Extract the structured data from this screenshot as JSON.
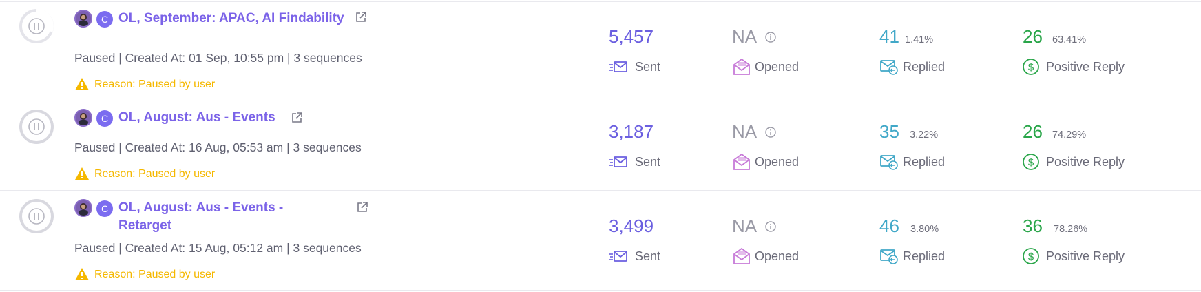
{
  "labels": {
    "sent": "Sent",
    "opened": "Opened",
    "replied": "Replied",
    "positive": "Positive Reply",
    "na": "NA",
    "badge": "C"
  },
  "colors": {
    "accent": "#7b63e8",
    "sent": "#6b5fe0",
    "opened": "#c77ad8",
    "replied": "#41a8c8",
    "positive": "#2aa64a",
    "warning": "#f5b800",
    "na": "#9a9aa6"
  },
  "campaigns": [
    {
      "title": "OL, September: APAC, AI Findability",
      "meta": "Paused | Created At: 01 Sep, 10:55 pm | 3 sequences",
      "reason": "Reason: Paused by user",
      "sent": "5,457",
      "replied": "41",
      "replied_pct": "1.41%",
      "positive": "26",
      "positive_pct": "63.41%"
    },
    {
      "title": "OL, August: Aus - Events",
      "meta": "Paused | Created At: 16 Aug, 05:53 am | 3 sequences",
      "reason": "Reason: Paused by user",
      "sent": "3,187",
      "replied": "35",
      "replied_pct": "3.22%",
      "positive": "26",
      "positive_pct": "74.29%"
    },
    {
      "title": "OL, August: Aus - Events - Retarget",
      "meta": "Paused | Created At: 15 Aug, 05:12 am | 3 sequences",
      "reason": "Reason: Paused by user",
      "sent": "3,499",
      "replied": "46",
      "replied_pct": "3.80%",
      "positive": "36",
      "positive_pct": "78.26%"
    }
  ]
}
